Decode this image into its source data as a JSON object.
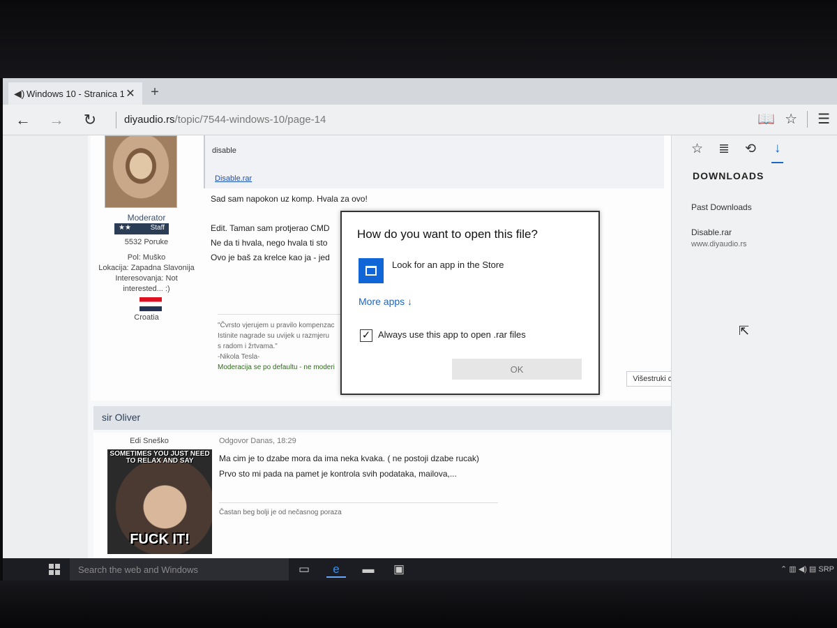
{
  "browser": {
    "tab_title": "Windows 10 - Stranica 1",
    "url_domain": "diyaudio.rs",
    "url_path": "/topic/7544-windows-10/page-14"
  },
  "post1": {
    "user": {
      "rank": "Moderator",
      "badge_stars": "★★",
      "badge": "Staff",
      "posts": "5532 Poruke",
      "gender": "Pol: Muško",
      "location": "Lokacija: Zapadna Slavonija",
      "interests_1": "Interesovanja: Not",
      "interests_2": "interested... :)",
      "country": "Croatia"
    },
    "code_text": "disable",
    "attachment": "Disable.rar",
    "line1": "Sad sam napokon uz komp. Hvala za ovo!",
    "line2": "Edit. Taman sam protjerao CMD",
    "line3": "Ne da ti hvala, nego hvala ti sto",
    "line4": "Ovo je baš za krelce kao ja - jed",
    "sig": {
      "l1": "\"Čvrsto vjerujem u pravilo kompenzac",
      "l2": "Istinite nagrade su uvijek u razmjeru",
      "l3": "s radom i žrtvama.\"",
      "l4": "-Nikola Tesla-",
      "l5": "Moderacija se po defaultu - ne moderi"
    },
    "multi_quote": "Višestruki cit"
  },
  "post2": {
    "author": "sir Oliver",
    "user_title": "Edi Sneško",
    "meme_top": "SOMETIMES YOU JUST NEED TO RELAX AND SAY",
    "meme_bottom": "FUCK IT!",
    "date": "Odgovor Danas, 18:29",
    "line1": "Ma cim je to dzabe mora da ima neka kvaka. ( ne postoji dzabe rucak)",
    "line2": "Prvo sto mi pada na pamet je kontrola svih podataka, mailova,...",
    "sig": "Častan beg bolji je od nečasnog poraza"
  },
  "hub": {
    "title": "DOWNLOADS",
    "past": "Past Downloads",
    "file": "Disable.rar",
    "site": "www.diyaudio.rs"
  },
  "dialog": {
    "title": "How do you want to open this file?",
    "store_option": "Look for an app in the Store",
    "more_apps": "More apps ↓",
    "always_use": "Always use this app to open .rar files",
    "ok": "OK"
  },
  "taskbar": {
    "search_placeholder": "Search the web and Windows",
    "tray_lang": "SRP"
  }
}
